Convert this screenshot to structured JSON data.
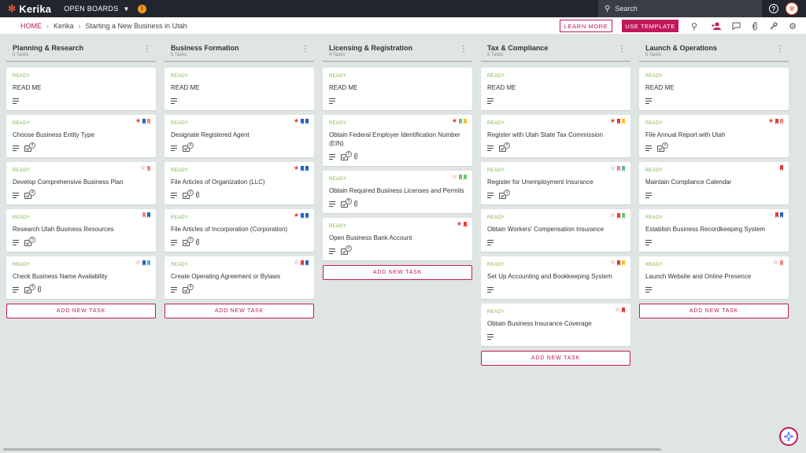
{
  "topbar": {
    "logo": "Kerika",
    "open_boards": "OPEN BOARDS",
    "notif": "!",
    "search_placeholder": "Search"
  },
  "breadcrumb": {
    "home": "HOME",
    "org": "Kerika",
    "board": "Starting a New Business in Utah"
  },
  "actions": {
    "learn_more": "LEARN MORE",
    "use_template": "USE TEMPLATE"
  },
  "add_task_label": "ADD NEW TASK",
  "colors": {
    "accent": "#c2185b",
    "ready": "#7cb342",
    "topbar": "#23252e",
    "star": "#e53935",
    "blue": "#1e63c5",
    "red": "#e53935",
    "salmon": "#ef8a7a",
    "teal": "#5bb5b0",
    "green": "#6ac46a",
    "yellow": "#f2c12e",
    "darkred": "#c62828"
  },
  "columns": [
    {
      "title": "Planning & Research",
      "count": "5 Tasks",
      "cards": [
        {
          "status": "READY",
          "title": "READ ME",
          "check": null,
          "clip": false,
          "star": null,
          "bookmarks": []
        },
        {
          "status": "READY",
          "title": "Choose Business Entity Type",
          "check": "4",
          "clip": false,
          "star": "filled",
          "bookmarks": [
            "blue",
            "salmon"
          ]
        },
        {
          "status": "READY",
          "title": "Develop Comprehensive Business Plan",
          "check": "4",
          "clip": false,
          "star": "outline",
          "bookmarks": [
            "salmon"
          ]
        },
        {
          "status": "READY",
          "title": "Research Utah Business Resources",
          "check": "5",
          "clip": false,
          "star": null,
          "bookmarks": [
            "salmon",
            "blue"
          ]
        },
        {
          "status": "READY",
          "title": "Check Business Name Availability",
          "check": "4",
          "clip": true,
          "star": "outline",
          "bookmarks": [
            "blue",
            "teal"
          ]
        }
      ]
    },
    {
      "title": "Business Formation",
      "count": "5 Tasks",
      "cards": [
        {
          "status": "READY",
          "title": "READ ME",
          "check": null,
          "clip": false,
          "star": null,
          "bookmarks": []
        },
        {
          "status": "READY",
          "title": "Designate Registered Agent",
          "check": "4",
          "clip": false,
          "star": "filled",
          "bookmarks": [
            "blue",
            "blue"
          ]
        },
        {
          "status": "READY",
          "title": "File Articles of Organization (LLC)",
          "check": "5",
          "clip": true,
          "star": "filled",
          "bookmarks": [
            "blue",
            "blue"
          ]
        },
        {
          "status": "READY",
          "title": "File Articles of Incorporation (Corporation)",
          "check": "5",
          "clip": true,
          "star": "filled",
          "bookmarks": [
            "blue",
            "blue"
          ]
        },
        {
          "status": "READY",
          "title": "Create Operating Agreement or Bylaws",
          "check": "4",
          "clip": false,
          "star": "outline",
          "bookmarks": [
            "red",
            "blue"
          ]
        }
      ]
    },
    {
      "title": "Licensing & Registration",
      "count": "4 Tasks",
      "cards": [
        {
          "status": "READY",
          "title": "READ ME",
          "check": null,
          "clip": false,
          "star": null,
          "bookmarks": []
        },
        {
          "status": "READY",
          "title": "Obtain Federal Employer Identification Number (EIN)",
          "check": "5",
          "clip": true,
          "star": "filled",
          "bookmarks": [
            "green",
            "yellow"
          ]
        },
        {
          "status": "READY",
          "title": "Obtain Required Business Licenses and Permits",
          "check": "5",
          "clip": true,
          "star": "outline",
          "bookmarks": [
            "green",
            "green"
          ]
        },
        {
          "status": "READY",
          "title": "Open Business Bank Account",
          "check": "4",
          "clip": false,
          "star": "filled",
          "bookmarks": [
            "red"
          ]
        }
      ]
    },
    {
      "title": "Tax & Compliance",
      "count": "6 Tasks",
      "cards": [
        {
          "status": "READY",
          "title": "READ ME",
          "check": null,
          "clip": false,
          "star": null,
          "bookmarks": []
        },
        {
          "status": "READY",
          "title": "Register with Utah State Tax Commission",
          "check": "4",
          "clip": false,
          "star": "filled",
          "bookmarks": [
            "red",
            "yellow"
          ]
        },
        {
          "status": "READY",
          "title": "Register for Unemployment Insurance",
          "check": "4",
          "clip": false,
          "star": "outline",
          "bookmarks": [
            "salmon",
            "teal"
          ]
        },
        {
          "status": "READY",
          "title": "Obtain Workers' Compensation Insurance",
          "check": null,
          "clip": false,
          "star": "outline",
          "bookmarks": [
            "red",
            "green"
          ]
        },
        {
          "status": "READY",
          "title": "Set Up Accounting and Bookkeeping System",
          "check": null,
          "clip": false,
          "star": "outline",
          "bookmarks": [
            "red",
            "yellow"
          ]
        },
        {
          "status": "READY",
          "title": "Obtain Business Insurance Coverage",
          "check": null,
          "clip": false,
          "star": "outline",
          "bookmarks": [
            "red"
          ]
        }
      ]
    },
    {
      "title": "Launch & Operations",
      "count": "5 Tasks",
      "cards": [
        {
          "status": "READY",
          "title": "READ ME",
          "check": null,
          "clip": false,
          "star": null,
          "bookmarks": []
        },
        {
          "status": "READY",
          "title": "File Annual Report with Utah",
          "check": "4",
          "clip": false,
          "star": "filled",
          "bookmarks": [
            "red",
            "salmon"
          ]
        },
        {
          "status": "READY",
          "title": "Maintain Compliance Calendar",
          "check": null,
          "clip": false,
          "star": null,
          "bookmarks": [
            "red"
          ]
        },
        {
          "status": "READY",
          "title": "Establish Business Recordkeeping System",
          "check": null,
          "clip": false,
          "star": null,
          "bookmarks": [
            "red",
            "blue"
          ]
        },
        {
          "status": "READY",
          "title": "Launch Website and Online Presence",
          "check": null,
          "clip": false,
          "star": "outline",
          "bookmarks": [
            "salmon"
          ]
        }
      ]
    }
  ]
}
